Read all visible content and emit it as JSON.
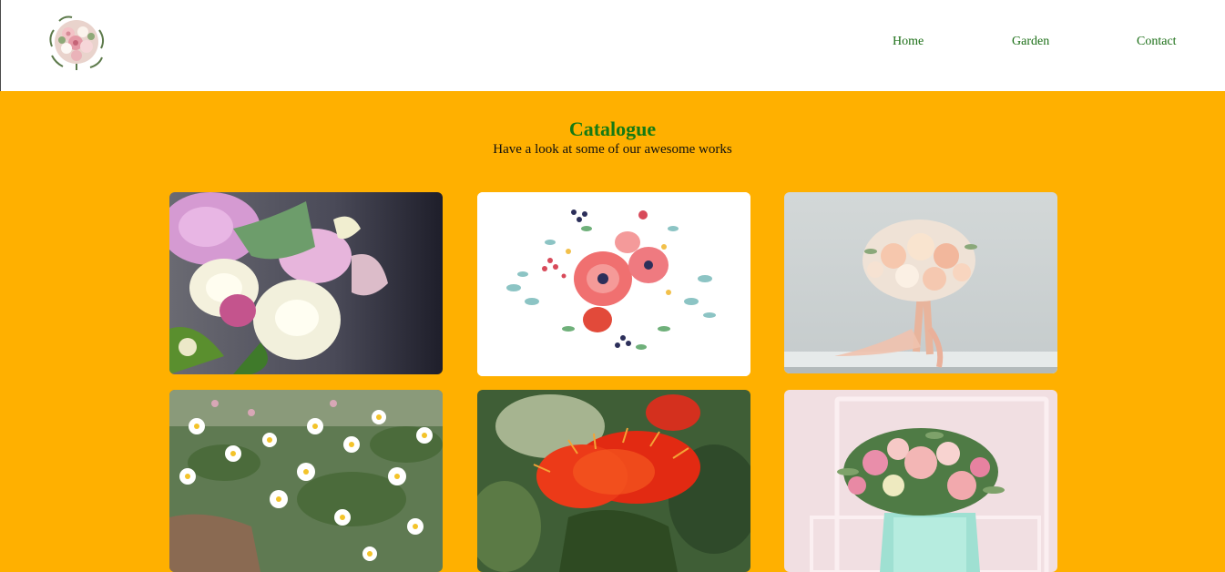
{
  "header": {
    "logo_icon": "flower-bouquet-logo-icon",
    "nav": [
      "Home",
      "Garden",
      "Contact"
    ]
  },
  "catalogue": {
    "title": "Catalogue",
    "subtitle": "Have a look at some of our awesome works"
  },
  "gallery": [
    {
      "image": "pink-peony-white-rose-bouquet-photo"
    },
    {
      "image": "watercolor-poppy-bouquet-illustration"
    },
    {
      "image": "peach-rose-bridal-bouquet-photo"
    },
    {
      "image": "white-daisy-field-photo"
    },
    {
      "image": "red-pohutukawa-blossom-photo"
    },
    {
      "image": "pink-roses-in-mint-box-photo"
    }
  ],
  "colors": {
    "page_background": "#ffb000",
    "header_background": "#ffffff",
    "nav_text": "#1b6e16",
    "title_text": "#157a13"
  }
}
